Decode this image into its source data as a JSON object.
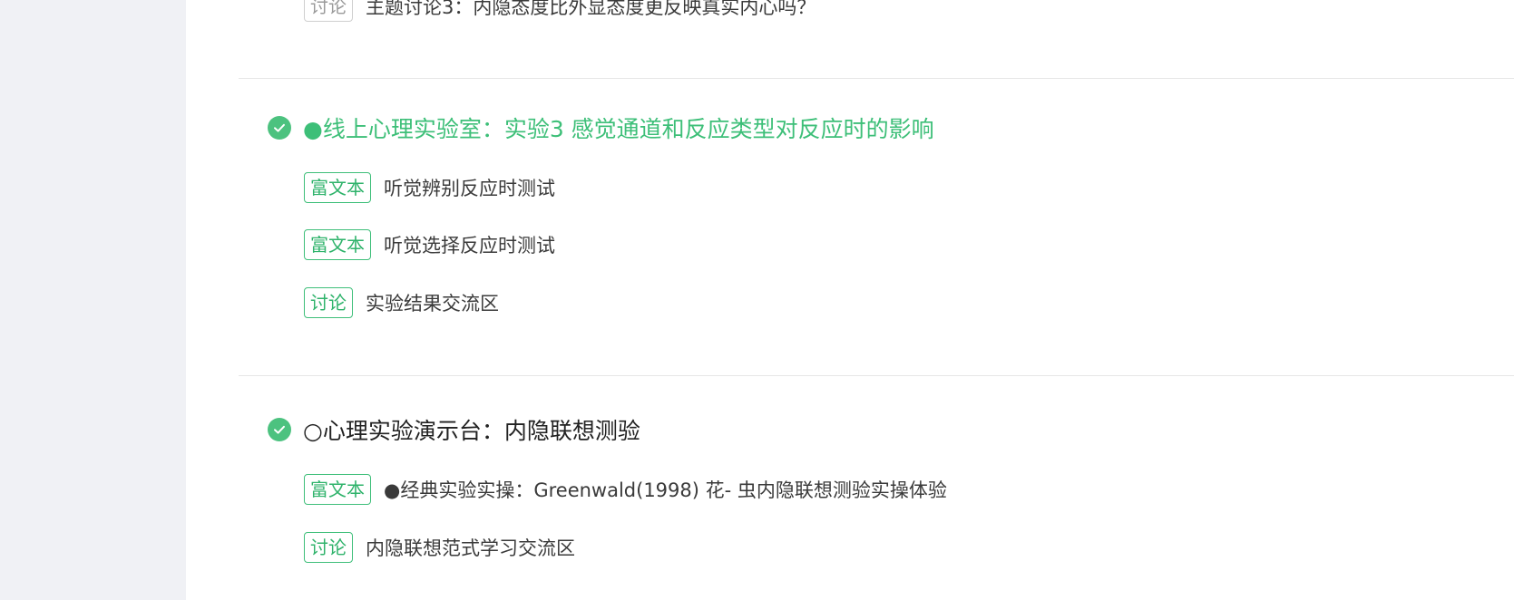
{
  "colors": {
    "accent": "#3dbf78",
    "check": "#4cc27f",
    "rail": "#f0f1f5",
    "divider": "#e6e6e6"
  },
  "top_item": {
    "tag": "讨论",
    "title": "主题讨论3：内隐态度比外显态度更反映真实内心吗？"
  },
  "section1": {
    "icon": "check-circle-icon",
    "title": "●线上心理实验室：实验3 感觉通道和反应类型对反应时的影响",
    "items": [
      {
        "tag": "富文本",
        "title": "听觉辨别反应时测试"
      },
      {
        "tag": "富文本",
        "title": "听觉选择反应时测试"
      },
      {
        "tag": "讨论",
        "title": "实验结果交流区"
      }
    ]
  },
  "section2": {
    "icon": "check-circle-icon",
    "title": "○心理实验演示台：内隐联想测验",
    "items": [
      {
        "tag": "富文本",
        "title": "●经典实验实操：Greenwald(1998)  花-  虫内隐联想测验实操体验"
      },
      {
        "tag": "讨论",
        "title": "内隐联想范式学习交流区"
      }
    ]
  }
}
